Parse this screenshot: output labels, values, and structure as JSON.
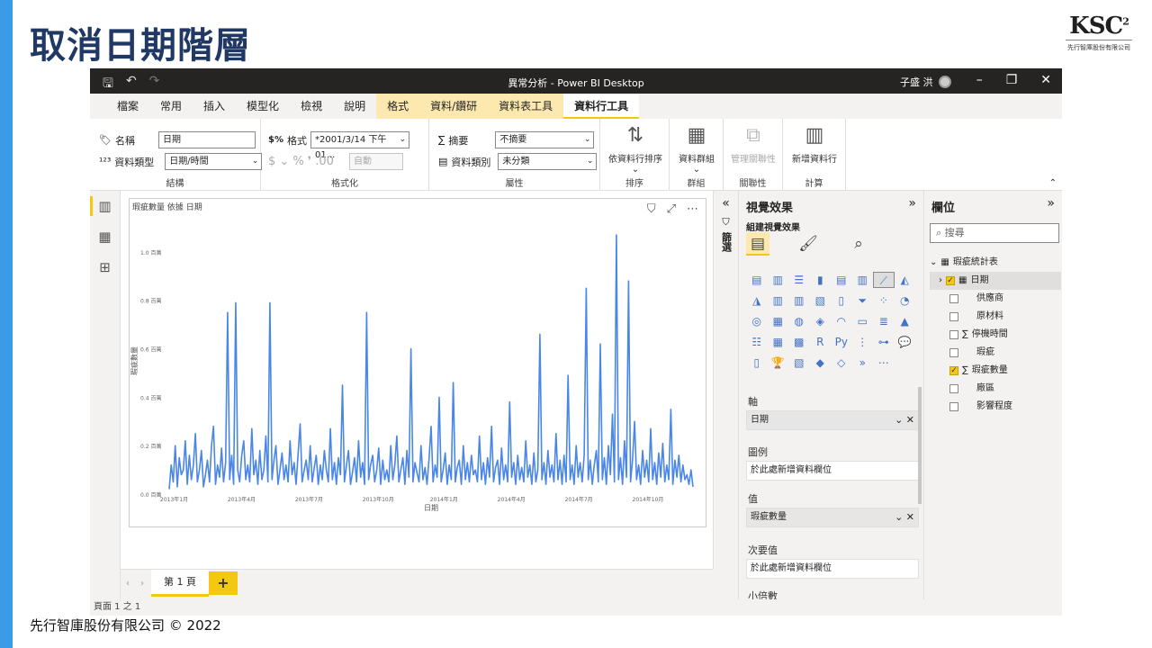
{
  "slide": {
    "title": "取消日期階層",
    "footer": "先行智庫股份有限公司 © 2022",
    "logo_mark": "KSC",
    "logo_sup": "2",
    "logo_sub": "先行智庫股份有限公司"
  },
  "window": {
    "title": "異常分析 - Power BI Desktop",
    "user": "子盛 洪"
  },
  "menu": [
    "檔案",
    "常用",
    "插入",
    "模型化",
    "檢視",
    "說明",
    "格式",
    "資料/鑽研",
    "資料表工具",
    "資料行工具"
  ],
  "ribbon": {
    "name_label": "名稱",
    "name_value": "日期",
    "datatype_label": "資料類型",
    "datatype_value": "日期/時間",
    "group_structure": "結構",
    "format_label": "格式",
    "format_value": "*2001/3/14 下午 01...",
    "format_symbols": "$ ⌄ %  ❜ .00",
    "auto_value": "自動",
    "group_format": "格式化",
    "summary_label": "摘要",
    "summary_value": "不摘要",
    "category_label": "資料類別",
    "category_value": "未分類",
    "group_props": "屬性",
    "sort_btn": "依資料行排序",
    "group_sort": "排序",
    "datagroup_btn": "資料群組",
    "group_groups": "群組",
    "manage_rel_btn": "管理關聯性",
    "group_rel": "關聯性",
    "new_col_btn": "新增資料行",
    "group_calc": "計算"
  },
  "visual": {
    "title": "瑕疵數量 依據 日期"
  },
  "chart_data": {
    "type": "line",
    "title": "瑕疵數量 依據 日期",
    "xlabel": "日期",
    "ylabel": "瑕疵數量",
    "ylim": [
      0,
      1.1
    ],
    "yticks": [
      "0.0 百萬",
      "0.2 百萬",
      "0.4 百萬",
      "0.6 百萬",
      "0.8 百萬",
      "1.0 百萬"
    ],
    "xticks": [
      "2013年1月",
      "2013年4月",
      "2013年7月",
      "2013年10月",
      "2014年1月",
      "2014年4月",
      "2014年7月",
      "2014年10月"
    ],
    "series": [
      {
        "values": [
          0.02,
          0.12,
          0.05,
          0.2,
          0.03,
          0.15,
          0.08,
          0.1,
          0.22,
          0.04,
          0.16,
          0.06,
          0.12,
          0.25,
          0.05,
          0.1,
          0.18,
          0.03,
          0.08,
          0.14,
          0.05,
          0.2,
          0.28,
          0.04,
          0.12,
          0.07,
          0.19,
          0.05,
          0.13,
          0.75,
          0.06,
          0.16,
          0.04,
          0.79,
          0.1,
          0.05,
          0.16,
          0.22,
          0.06,
          0.12,
          0.05,
          0.27,
          0.08,
          0.14,
          0.04,
          0.18,
          0.06,
          0.1,
          0.24,
          0.05,
          0.79,
          0.06,
          0.14,
          0.2,
          0.04,
          0.1,
          0.17,
          0.06,
          0.12,
          0.05,
          0.22,
          0.08,
          0.13,
          0.04,
          0.17,
          0.29,
          0.05,
          0.1,
          0.14,
          0.06,
          0.2,
          0.05,
          0.11,
          0.16,
          0.04,
          0.12,
          0.06,
          0.18,
          0.1,
          0.05,
          0.27,
          0.06,
          0.13,
          0.04,
          0.15,
          0.08,
          0.45,
          0.05,
          0.12,
          0.18,
          0.04,
          0.09,
          0.15,
          0.05,
          0.22,
          0.07,
          0.13,
          0.04,
          0.75,
          0.06,
          0.12,
          0.16,
          0.05,
          0.1,
          0.19,
          0.04,
          0.14,
          0.06,
          0.1,
          0.05,
          0.2,
          0.06,
          0.12,
          0.24,
          0.05,
          0.1,
          0.15,
          0.04,
          0.18,
          0.07,
          0.6,
          0.05,
          0.13,
          0.09,
          0.05,
          0.2,
          0.06,
          0.11,
          0.04,
          0.15,
          0.28,
          0.05,
          0.12,
          0.07,
          0.4,
          0.05,
          0.1,
          0.17,
          0.04,
          0.12,
          0.06,
          0.46,
          0.05,
          0.11,
          0.14,
          0.04,
          0.2,
          0.06,
          0.13,
          0.05,
          0.16,
          0.08,
          0.1,
          0.05,
          0.24,
          0.06,
          0.13,
          0.04,
          0.15,
          0.07,
          0.28,
          0.05,
          0.11,
          0.14,
          0.04,
          0.19,
          0.06,
          0.12,
          0.05,
          0.38,
          0.07,
          0.13,
          0.04,
          0.16,
          0.06,
          0.11,
          0.05,
          0.22,
          0.07,
          0.12,
          0.04,
          0.17,
          0.05,
          0.1,
          0.66,
          0.06,
          0.13,
          0.04,
          0.18,
          0.07,
          0.12,
          0.05,
          0.25,
          0.06,
          0.14,
          0.04,
          0.16,
          0.05,
          0.49,
          0.06,
          0.12,
          0.04,
          0.2,
          0.07,
          0.13,
          0.05,
          0.16,
          0.85,
          0.06,
          0.14,
          0.04,
          0.12,
          0.18,
          0.05,
          0.62,
          0.06,
          0.15,
          0.04,
          0.2,
          0.08,
          0.33,
          0.05,
          1.07,
          0.06,
          0.15,
          0.04,
          0.22,
          0.07,
          0.88,
          0.05,
          0.14,
          0.3,
          0.06,
          0.12,
          0.04,
          0.18,
          0.07,
          0.14,
          0.05,
          0.27,
          0.06,
          0.13,
          0.04,
          0.17,
          0.07,
          0.21,
          0.05,
          0.12,
          0.06,
          0.35,
          0.04,
          0.14,
          0.07,
          0.16,
          0.05,
          0.12,
          0.06,
          0.08,
          0.04,
          0.1,
          0.03
        ]
      }
    ]
  },
  "pages": {
    "tab": "第 1 頁",
    "add": "+",
    "status": "頁面 1 之 1"
  },
  "filters": {
    "label": "篩選"
  },
  "viz_pane": {
    "title": "視覺效果",
    "subtitle": "組建視覺效果",
    "axis_label": "軸",
    "axis_value": "日期",
    "legend_label": "圖例",
    "legend_placeholder": "於此處新增資料欄位",
    "values_label": "值",
    "values_value": "瑕疵數量",
    "secondary_label": "次要值",
    "secondary_placeholder": "於此處新增資料欄位",
    "multiples_label": "小倍數"
  },
  "fields_pane": {
    "title": "欄位",
    "search_placeholder": "搜尋",
    "table": "瑕疵統計表",
    "items": [
      "日期",
      "供應商",
      "原材料",
      "停機時間",
      "瑕疵",
      "瑕疵數量",
      "廠區",
      "影響程度"
    ]
  },
  "colors": {
    "accent": "#3a9ce8",
    "title": "#1f3864",
    "line": "#4a86e8",
    "pbi_yellow": "#f2c811"
  }
}
